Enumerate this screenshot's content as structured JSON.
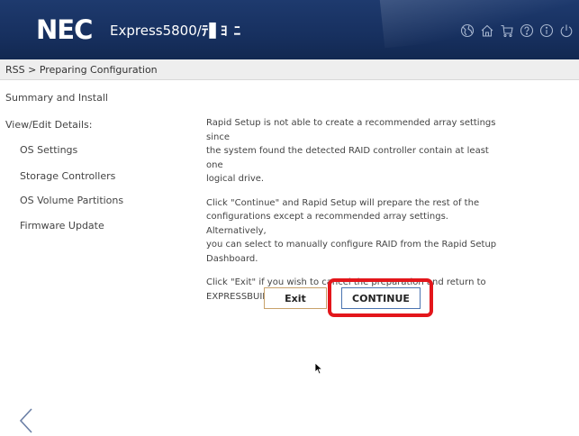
{
  "header": {
    "logo": "NEC",
    "product_prefix": "Express5800/",
    "product_suffix": "ﾃ▋ﾖ ﾆ",
    "icons": [
      "globe-icon",
      "home-icon",
      "cart-icon",
      "help-icon",
      "info-icon",
      "power-icon"
    ]
  },
  "breadcrumb": "RSS > Preparing Configuration",
  "sidebar": {
    "summary": "Summary and Install",
    "view_edit": "View/Edit Details:",
    "os_settings": "OS Settings",
    "storage_controllers": "Storage Controllers",
    "os_volume_partitions": "OS Volume Partitions",
    "firmware_update": "Firmware Update"
  },
  "main": {
    "para1_line1": "Rapid Setup is not able to create a recommended array settings since",
    "para1_line2": "the system found the detected RAID controller contain at least one",
    "para1_line3": "logical drive.",
    "para2_line1": "Click \"Continue\" and Rapid Setup will prepare the rest of the",
    "para2_line2": "configurations except a recommended array settings. Alternatively,",
    "para2_line3": "you can select to manually configure RAID from the Rapid Setup",
    "para2_line4": "Dashboard.",
    "para3_line1": "Click \"Exit\" if you wish to cancel the preparation and return to",
    "para3_line2": "EXPRESSBUILDER."
  },
  "buttons": {
    "exit": "Exit",
    "continue": "CONTINUE"
  },
  "colors": {
    "header_bg": "#17305f",
    "highlight": "#e3161b",
    "exit_border": "#c9a26b",
    "continue_border": "#4a74b0"
  }
}
